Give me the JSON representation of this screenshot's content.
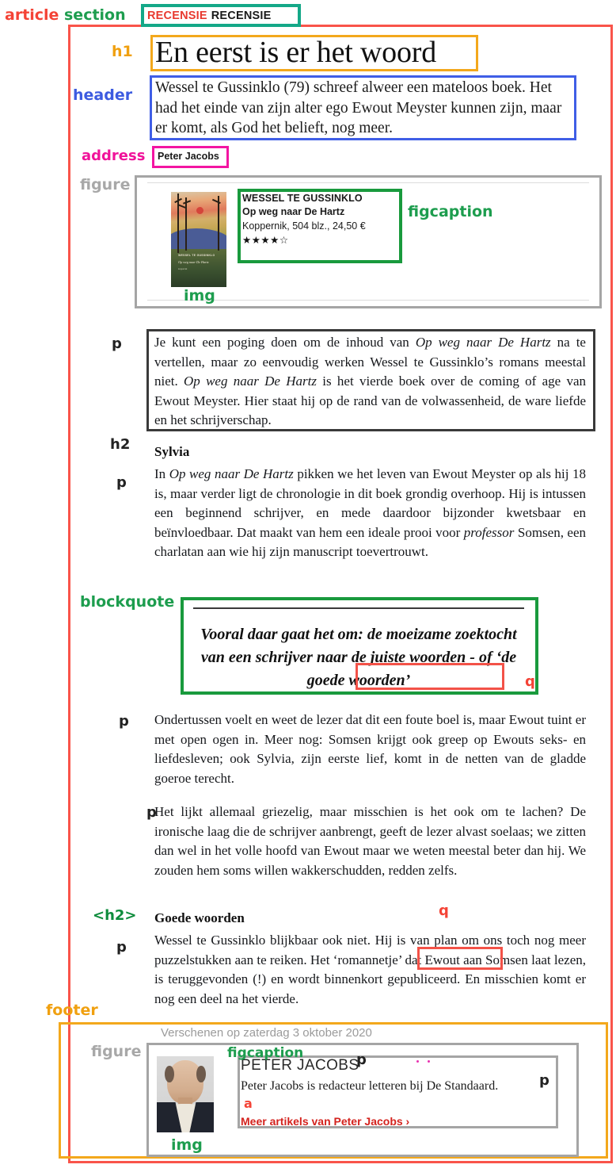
{
  "section": {
    "kicker_red": "RECENSIE",
    "kicker_black": "RECENSIE"
  },
  "article": {
    "h1": "En eerst is er het woord",
    "standfirst": "Wessel te Gussinklo (79) schreef alweer een mateloos boek. Het had het einde van zijn alter ego Ewout Meyster kunnen zijn, maar er komt, als God het belieft, nog meer.",
    "address": "Peter Jacobs",
    "book_figure": {
      "caption_author": "WESSEL TE GUSSINKLO",
      "caption_title": "Op weg naar De Hartz",
      "caption_publisher": "Koppernik, 504 blz., 24,50 €",
      "caption_rating": "★★★★☆",
      "cover_author": "WESSEL TE GUSSINKLO",
      "cover_title": "Op weg naar De Hartz",
      "cover_pub": "koppernik"
    },
    "p1_a": "Je kunt een poging doen om de inhoud van ",
    "p1_i1": "Op weg naar De Hartz",
    "p1_b": " na te vertellen, maar zo eenvoudig werken Wessel te Gussinklo’s romans meestal niet. ",
    "p1_i2": "Op weg naar De Hartz",
    "p1_c": " is het vierde boek over de coming of age van Ewout Meyster. Hier staat hij op de rand van de volwassenheid, de ware liefde en het schrijverschap.",
    "h2_sylvia": "Sylvia",
    "p2_a": "In ",
    "p2_i1": "Op weg naar De Hartz",
    "p2_b": " pikken we het leven van Ewout Meyster op als hij 18 is, maar verder ligt de chronologie in dit boek grondig overhoop. Hij is intussen een beginnend schrijver, en mede daardoor bijzonder kwetsbaar en beïnvloedbaar. Dat maakt van hem een ideale prooi voor ",
    "p2_i2": "professor",
    "p2_c": " Somsen, een charlatan aan wie hij zijn manuscript toevertrouwt.",
    "blockquote_a": "Vooral daar gaat het om: de moeizame zoektocht van een schrijver naar de juiste woorden - of ",
    "blockquote_q": "‘de goede woorden’",
    "p3": "Ondertussen voelt en weet de lezer dat dit een foute boel is, maar Ewout tuint er met open ogen in. Meer nog: Somsen krijgt ook greep op Ewouts seks- en liefdesleven; ook Sylvia, zijn eerste lief, komt in de netten van de gladde goeroe terecht.",
    "p4": "Het lijkt allemaal griezelig, maar misschien is het ook om te lachen? De ironische laag die de schrijver aanbrengt, geeft de lezer alvast soelaas; we zitten dan wel in het volle hoofd van Ewout maar we weten meestal beter dan hij. We zouden hem soms willen wakkerschudden, redden zelfs.",
    "h2_goede": "Goede woorden",
    "p5_a": "Wessel te Gussinklo blijkbaar ook niet. Hij is van plan om ons toch nog meer puzzelstukken aan te reiken. Het ",
    "p5_q": "‘romannetje’",
    "p5_b": " dat Ewout aan Somsen laat lezen, is teruggevonden (!) en wordt binnenkort gepubliceerd. En misschien komt er nog een deel na het vierde."
  },
  "footer": {
    "pubdate": "Verschenen op zaterdag 3 oktober 2020",
    "author_name": "PETER JACOBS",
    "author_bio": "Peter Jacobs is redacteur letteren bij De Standaard.",
    "author_link": "Meer artikels van Peter Jacobs ›"
  },
  "annotations": {
    "article": "article",
    "section": "section",
    "h1": "h1",
    "header": "header",
    "address": "address",
    "figure": "figure",
    "figcaption": "figcaption",
    "img": "img",
    "p": "p",
    "h2": "h2",
    "blockquote": "blockquote",
    "q": "q",
    "h2_angle": "<h2>",
    "footer": "footer",
    "figure2": "figure",
    "figcaption2": "figcaption",
    "img2": "img",
    "a": "a"
  },
  "colors": {
    "article": "#f9544a",
    "section": "#14a888",
    "h1": "#f3a81c",
    "header": "#3f5ee6",
    "address": "#f315a2",
    "figure": "#a5a5a5",
    "figcaption": "#199a3d",
    "p": "#3a3a3a",
    "blockquote": "#199a3d",
    "q": "#f35248",
    "footer": "#f3a81c",
    "kicker_red": "#e8392f"
  }
}
